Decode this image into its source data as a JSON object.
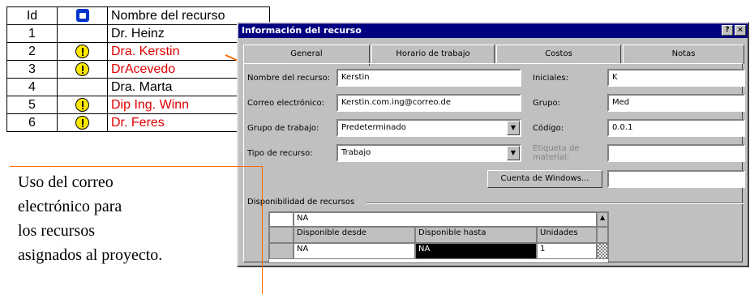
{
  "sheet": {
    "headers": {
      "id": "Id",
      "name": "Nombre del recurso"
    },
    "rows": [
      {
        "id": "1",
        "name": "Dr. Heinz",
        "warn": false,
        "red": false
      },
      {
        "id": "2",
        "name": "Dra. Kerstin",
        "warn": true,
        "red": true
      },
      {
        "id": "3",
        "name": "DrAcevedo",
        "warn": true,
        "red": true
      },
      {
        "id": "4",
        "name": "Dra. Marta",
        "warn": false,
        "red": false
      },
      {
        "id": "5",
        "name": "Dip Ing. Winn",
        "warn": true,
        "red": true
      },
      {
        "id": "6",
        "name": "Dr. Feres",
        "warn": true,
        "red": true
      }
    ]
  },
  "dialog": {
    "title": "Información del recurso",
    "tabs": [
      "General",
      "Horario de trabajo",
      "Costos",
      "Notas"
    ],
    "labels": {
      "name": "Nombre del recurso:",
      "email": "Correo electrónico:",
      "workgroup": "Grupo de trabajo:",
      "type": "Tipo de recurso:",
      "initials": "Iniciales:",
      "group": "Grupo:",
      "code": "Código:",
      "material": "Etiqueta de material:",
      "availability": "Disponibilidad de recursos"
    },
    "values": {
      "name": "Kerstin",
      "email": "Kerstin.com.ing@correo.de",
      "workgroup": "Predeterminado",
      "type": "Trabajo",
      "initials": "K",
      "group": "Med",
      "code": "0.0.1",
      "material": ""
    },
    "buttons": {
      "windows_account": "Cuenta de Windows..."
    },
    "availability": {
      "top_value": "NA",
      "headers": [
        "Disponible desde",
        "Disponible hasta",
        "Unidades"
      ],
      "row": [
        "NA",
        "NA",
        "1"
      ]
    }
  },
  "note": {
    "lines": [
      "Uso del correo",
      "electrónico para",
      "los recursos",
      "asignados al proyecto."
    ]
  }
}
